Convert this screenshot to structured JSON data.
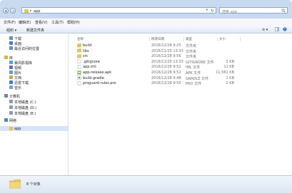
{
  "address": {
    "crumb": "app",
    "sep": "▸",
    "dropdown": "▾",
    "refresh": "↻",
    "search_placeholder": "搜索 app"
  },
  "menu": [
    "文件(F)",
    "编辑(E)",
    "查看(V)",
    "工具(T)",
    "帮助(H)"
  ],
  "toolbar": {
    "organize": "组织 ▾",
    "new_folder": "新建文件夹",
    "view_label": "≡ ▾"
  },
  "nav": [
    {
      "label": "下载",
      "icon": "download-folder-icon",
      "color": "#5b8fd6"
    },
    {
      "label": "桌面",
      "icon": "desktop-icon",
      "color": "#4a7cc2"
    },
    {
      "label": "最近访问的位置",
      "icon": "recent-places-icon",
      "color": "#6a8fb8"
    },
    {
      "label": "库",
      "icon": "library-icon",
      "color": "#d9b44a",
      "group": true
    },
    {
      "label": "暴风影视库",
      "icon": "video-library-icon",
      "color": "#4aa6d9"
    },
    {
      "label": "视频",
      "icon": "video-icon",
      "color": "#6b6bb8"
    },
    {
      "label": "图片",
      "icon": "pictures-icon",
      "color": "#5aa0d0"
    },
    {
      "label": "文档",
      "icon": "documents-icon",
      "color": "#c8a656"
    },
    {
      "label": "迅雷下载",
      "icon": "thunder-download-icon",
      "color": "#3a7fd0"
    },
    {
      "label": "音乐",
      "icon": "music-icon",
      "color": "#7a9cd0"
    },
    {
      "label": "计算机",
      "icon": "computer-icon",
      "color": "#6a86a8",
      "group": true
    },
    {
      "label": "本地磁盘 (C:)",
      "icon": "drive-icon",
      "color": "#8a9ab0"
    },
    {
      "label": "本地磁盘 (D:)",
      "icon": "drive-icon",
      "color": "#8a9ab0"
    },
    {
      "label": "本地磁盘 (E:)",
      "icon": "drive-icon",
      "color": "#8a9ab0"
    },
    {
      "label": "网络",
      "icon": "network-icon",
      "color": "#4f84b9",
      "group": true
    },
    {
      "label": "app",
      "icon": "folder-icon",
      "color": "#e6c45a",
      "selected": true
    }
  ],
  "columns": {
    "name": "名称",
    "date": "修改日期",
    "type": "类型",
    "size": "大小"
  },
  "files": [
    {
      "name": "build",
      "date": "2016/12/28 9:25",
      "type": "文件夹",
      "size": "",
      "icon": "folder"
    },
    {
      "name": "libs",
      "date": "2016/11/25 13:33",
      "type": "文件夹",
      "size": "",
      "icon": "folder"
    },
    {
      "name": "src",
      "date": "2016/12/28 9:56",
      "type": "文件夹",
      "size": "",
      "icon": "folder"
    },
    {
      "name": ".gitignore",
      "date": "2016/11/25 13:33",
      "type": "GITIGNORE 文件",
      "size": "1 KB",
      "icon": "file"
    },
    {
      "name": "app.iml",
      "date": "2016/12/28 9:52",
      "type": "IML 文件",
      "size": "11 KB",
      "icon": "file"
    },
    {
      "name": "app-release.apk",
      "date": "2016/12/28 9:52",
      "type": "APK 文件",
      "size": "11,561 KB",
      "icon": "apk"
    },
    {
      "name": "build.gradle",
      "date": "2016/12/28 9:48",
      "type": "GRADLE 文件",
      "size": "1 KB",
      "icon": "gradle"
    },
    {
      "name": "proguard-rules.pro",
      "date": "2016/12/28 9:55",
      "type": "PRO 文件",
      "size": "2 KB",
      "icon": "file"
    }
  ],
  "status": {
    "count": "8 个对象"
  }
}
